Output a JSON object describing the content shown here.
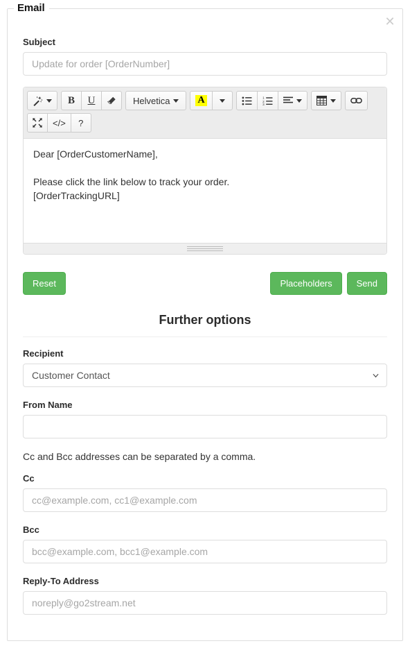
{
  "panel": {
    "legend": "Email",
    "close_icon": "close-icon"
  },
  "subject": {
    "label": "Subject",
    "placeholder": "Update for order [OrderNumber]",
    "value": ""
  },
  "editor": {
    "toolbar": {
      "style_dropdown": {
        "icon": "magic-wand-icon",
        "label": ""
      },
      "bold": "B",
      "underline": "U",
      "remove_format": {
        "icon": "eraser-icon"
      },
      "font_name": "Helvetica",
      "font_color": {
        "letter": "A",
        "highlight": "#ffff00"
      },
      "unordered_list": {
        "icon": "unordered-list-icon"
      },
      "ordered_list": {
        "icon": "ordered-list-icon"
      },
      "paragraph_align": {
        "icon": "align-left-icon"
      },
      "table": {
        "icon": "table-icon"
      },
      "link": {
        "icon": "link-icon"
      },
      "fullscreen": {
        "icon": "fullscreen-icon"
      },
      "code_view": {
        "icon": "code-view-icon",
        "label": "</>"
      },
      "help": {
        "icon": "help-icon",
        "label": "?"
      }
    },
    "content": {
      "line1": "Dear [OrderCustomerName],",
      "line2": "Please click the link below to track your order.",
      "line3": "[OrderTrackingURL]"
    }
  },
  "actions": {
    "reset_label": "Reset",
    "placeholders_label": "Placeholders",
    "send_label": "Send",
    "accent_color": "#5cb85c"
  },
  "further_options": {
    "title": "Further options",
    "recipient": {
      "label": "Recipient",
      "value": "Customer Contact",
      "options": [
        "Customer Contact"
      ]
    },
    "from_name": {
      "label": "From Name",
      "value": "",
      "placeholder": ""
    },
    "helper_text": "Cc and Bcc addresses can be separated by a comma.",
    "cc": {
      "label": "Cc",
      "value": "",
      "placeholder": "cc@example.com, cc1@example.com"
    },
    "bcc": {
      "label": "Bcc",
      "value": "",
      "placeholder": "bcc@example.com, bcc1@example.com"
    },
    "reply_to": {
      "label": "Reply-To Address",
      "value": "",
      "placeholder": "noreply@go2stream.net"
    }
  }
}
